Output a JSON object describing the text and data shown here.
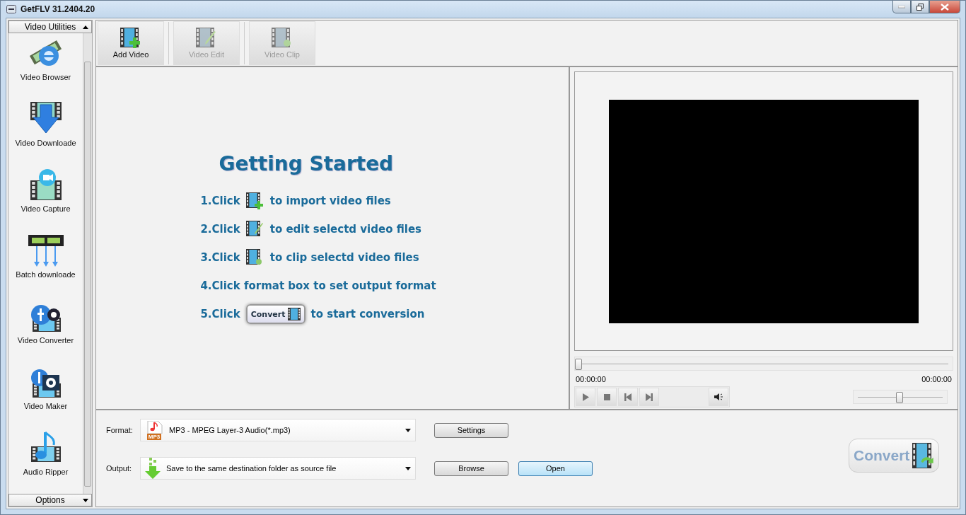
{
  "window": {
    "title": "GetFLV 31.2404.20"
  },
  "sidebar": {
    "header": "Video Utilities",
    "footer": "Options",
    "items": [
      {
        "label": "Video Browser"
      },
      {
        "label": "Video Downloade"
      },
      {
        "label": "Video Capture"
      },
      {
        "label": "Batch downloade"
      },
      {
        "label": "Video Converter"
      },
      {
        "label": "Video Maker"
      },
      {
        "label": "Audio Ripper"
      }
    ]
  },
  "toolbar": [
    {
      "label": "Add Video",
      "disabled": false
    },
    {
      "label": "Video Edit",
      "disabled": true
    },
    {
      "label": "Video Clip",
      "disabled": true
    }
  ],
  "getting_started": {
    "title": "Getting Started",
    "steps": [
      {
        "kind": "icon",
        "before": "1.Click",
        "after": "to import video files"
      },
      {
        "kind": "icon",
        "before": "2.Click",
        "after": "to edit selectd video files"
      },
      {
        "kind": "icon",
        "before": "3.Click",
        "after": "to clip selectd video files"
      },
      {
        "kind": "text",
        "before": "4.Click format box to set output format"
      },
      {
        "kind": "button",
        "before": "5.Click",
        "button": "Convert",
        "after": "to start conversion"
      }
    ]
  },
  "player": {
    "seek": {
      "level": 0
    },
    "time_start": "00:00:00",
    "time_end": "00:00:00",
    "volume": {
      "level": 0.5
    }
  },
  "format": {
    "label": "Format:",
    "value": "MP3 - MPEG Layer-3 Audio(*.mp3)",
    "badge": "MP3"
  },
  "output": {
    "label": "Output:",
    "value": "Save to the same destination folder as source file"
  },
  "buttons": {
    "settings": "Settings",
    "browse": "Browse",
    "open": "Open",
    "convert": "Convert"
  }
}
